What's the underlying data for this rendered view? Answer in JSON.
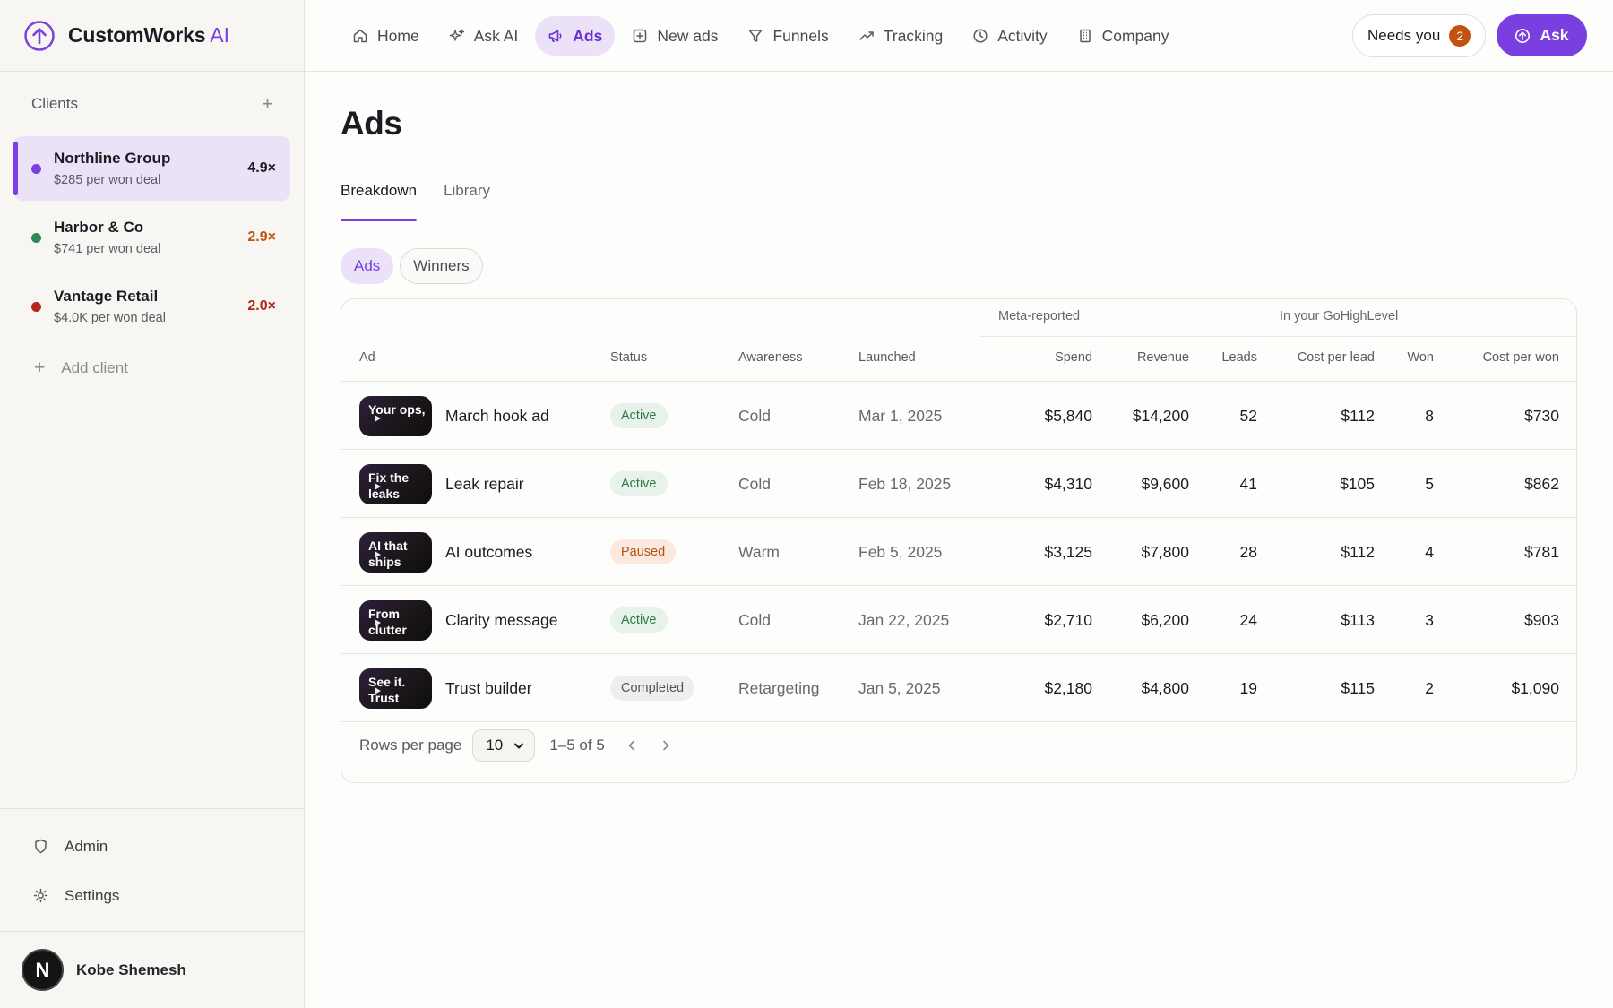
{
  "brand": {
    "name": "CustomWorks",
    "suffix": "AI"
  },
  "sidebar": {
    "clients_title": "Clients",
    "clients": [
      {
        "name": "Northline Group",
        "sub": "$285 per won deal",
        "mult": "4.9×",
        "dot_color": "#7a3fe0",
        "mult_color": "#1c1b22"
      },
      {
        "name": "Harbor & Co",
        "sub": "$741 per won deal",
        "mult": "2.9×",
        "dot_color": "#2f8a5a",
        "mult_color": "#c2520e"
      },
      {
        "name": "Vantage Retail",
        "sub": "$4.0K per won deal",
        "mult": "2.0×",
        "dot_color": "#b3261e",
        "mult_color": "#b3261e"
      }
    ],
    "add_client": "Add client",
    "admin": "Admin",
    "settings": "Settings",
    "user": {
      "initial": "N",
      "name": "Kobe Shemesh"
    }
  },
  "nav": {
    "items": [
      {
        "label": "Home",
        "icon": "home-icon"
      },
      {
        "label": "Ask AI",
        "icon": "sparkle-icon"
      },
      {
        "label": "Ads",
        "icon": "megaphone-icon"
      },
      {
        "label": "New ads",
        "icon": "plus-square-icon"
      },
      {
        "label": "Funnels",
        "icon": "funnel-icon"
      },
      {
        "label": "Tracking",
        "icon": "trend-icon"
      },
      {
        "label": "Activity",
        "icon": "clock-icon"
      },
      {
        "label": "Company",
        "icon": "building-icon"
      }
    ],
    "active": "Ads",
    "needs_you": "Needs you",
    "needs_count": "2",
    "ask": "Ask"
  },
  "main": {
    "title": "Ads",
    "tabs": [
      "Breakdown",
      "Library"
    ],
    "pills": [
      "Ads",
      "Winners"
    ],
    "groups": {
      "meta": "Meta-reported",
      "ghl": "In your GoHighLevel"
    },
    "columns": [
      "Ad",
      "Status",
      "Awareness",
      "Launched",
      "Spend",
      "Revenue",
      "Leads",
      "Cost per lead",
      "Won",
      "Cost per won"
    ],
    "rows": [
      {
        "thumb": "Your ops,",
        "name": "March hook ad",
        "status": "Active",
        "awareness": "Cold",
        "launched": "Mar 1, 2025",
        "spend": "$5,840",
        "revenue": "$14,200",
        "leads": "52",
        "cpl": "$112",
        "won": "8",
        "cpw": "$730"
      },
      {
        "thumb": "Fix the leaks",
        "name": "Leak repair",
        "status": "Active",
        "awareness": "Cold",
        "launched": "Feb 18, 2025",
        "spend": "$4,310",
        "revenue": "$9,600",
        "leads": "41",
        "cpl": "$105",
        "won": "5",
        "cpw": "$862"
      },
      {
        "thumb": "AI that ships",
        "name": "AI outcomes",
        "status": "Paused",
        "awareness": "Warm",
        "launched": "Feb 5, 2025",
        "spend": "$3,125",
        "revenue": "$7,800",
        "leads": "28",
        "cpl": "$112",
        "won": "4",
        "cpw": "$781"
      },
      {
        "thumb": "From clutter",
        "name": "Clarity message",
        "status": "Active",
        "awareness": "Cold",
        "launched": "Jan 22, 2025",
        "spend": "$2,710",
        "revenue": "$6,200",
        "leads": "24",
        "cpl": "$113",
        "won": "3",
        "cpw": "$903"
      },
      {
        "thumb": "See it. Trust",
        "name": "Trust builder",
        "status": "Completed",
        "awareness": "Retargeting",
        "launched": "Jan 5, 2025",
        "spend": "$2,180",
        "revenue": "$4,800",
        "leads": "19",
        "cpl": "$115",
        "won": "2",
        "cpw": "$1,090"
      }
    ],
    "status_colors": {
      "Active": {
        "bg": "#e6f2ea",
        "fg": "#2f7a4c"
      },
      "Paused": {
        "bg": "#fbe9df",
        "fg": "#b5510f"
      },
      "Completed": {
        "bg": "#efeeec",
        "fg": "#55535c"
      }
    },
    "footer": {
      "rows_per_page": "Rows per page",
      "per_page_value": "10",
      "range": "1–5 of 5"
    }
  }
}
